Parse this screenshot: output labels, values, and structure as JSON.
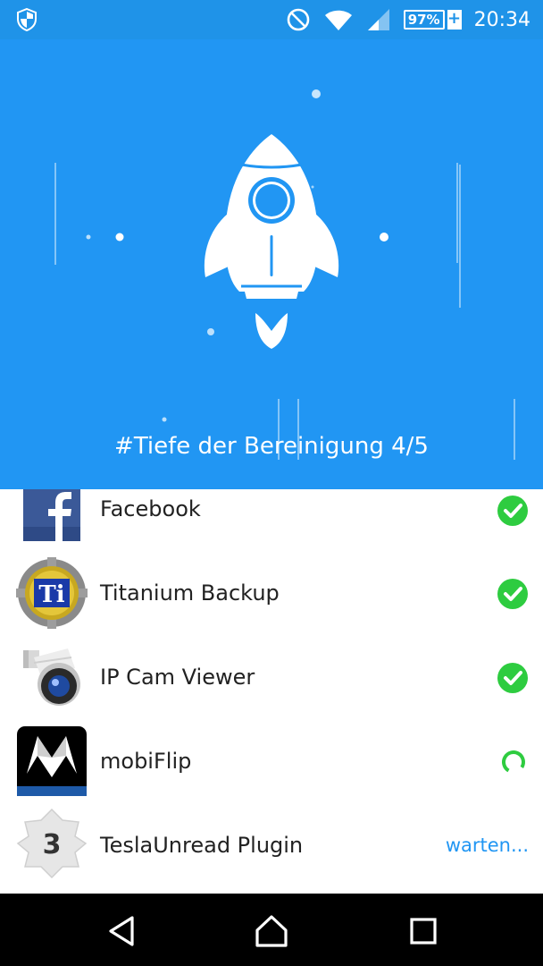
{
  "status_bar": {
    "battery_percent": "97%",
    "charging_symbol": "+",
    "time": "20:34",
    "icons": [
      "shield-icon",
      "do-not-disturb-icon",
      "wifi-icon",
      "cell-signal-icon",
      "battery-icon"
    ]
  },
  "hero": {
    "title": "#Tiefe der Bereinigung 4/5",
    "icon": "rocket-icon",
    "background_color": "#2196f3"
  },
  "apps": [
    {
      "name": "Facebook",
      "icon": "facebook-icon",
      "state": "done"
    },
    {
      "name": "Titanium Backup",
      "icon": "titanium-backup-icon",
      "state": "done"
    },
    {
      "name": "IP Cam Viewer",
      "icon": "ip-cam-viewer-icon",
      "state": "done"
    },
    {
      "name": "mobiFlip",
      "icon": "mobiflip-icon",
      "state": "in-progress"
    },
    {
      "name": "TeslaUnread Plugin",
      "icon": "teslaunread-icon",
      "state": "waiting",
      "state_label": "warten..."
    }
  ],
  "colors": {
    "accent": "#2196f3",
    "success": "#2ecc40"
  },
  "nav_bar": {
    "icons": [
      "back-icon",
      "home-icon",
      "recents-icon"
    ]
  }
}
